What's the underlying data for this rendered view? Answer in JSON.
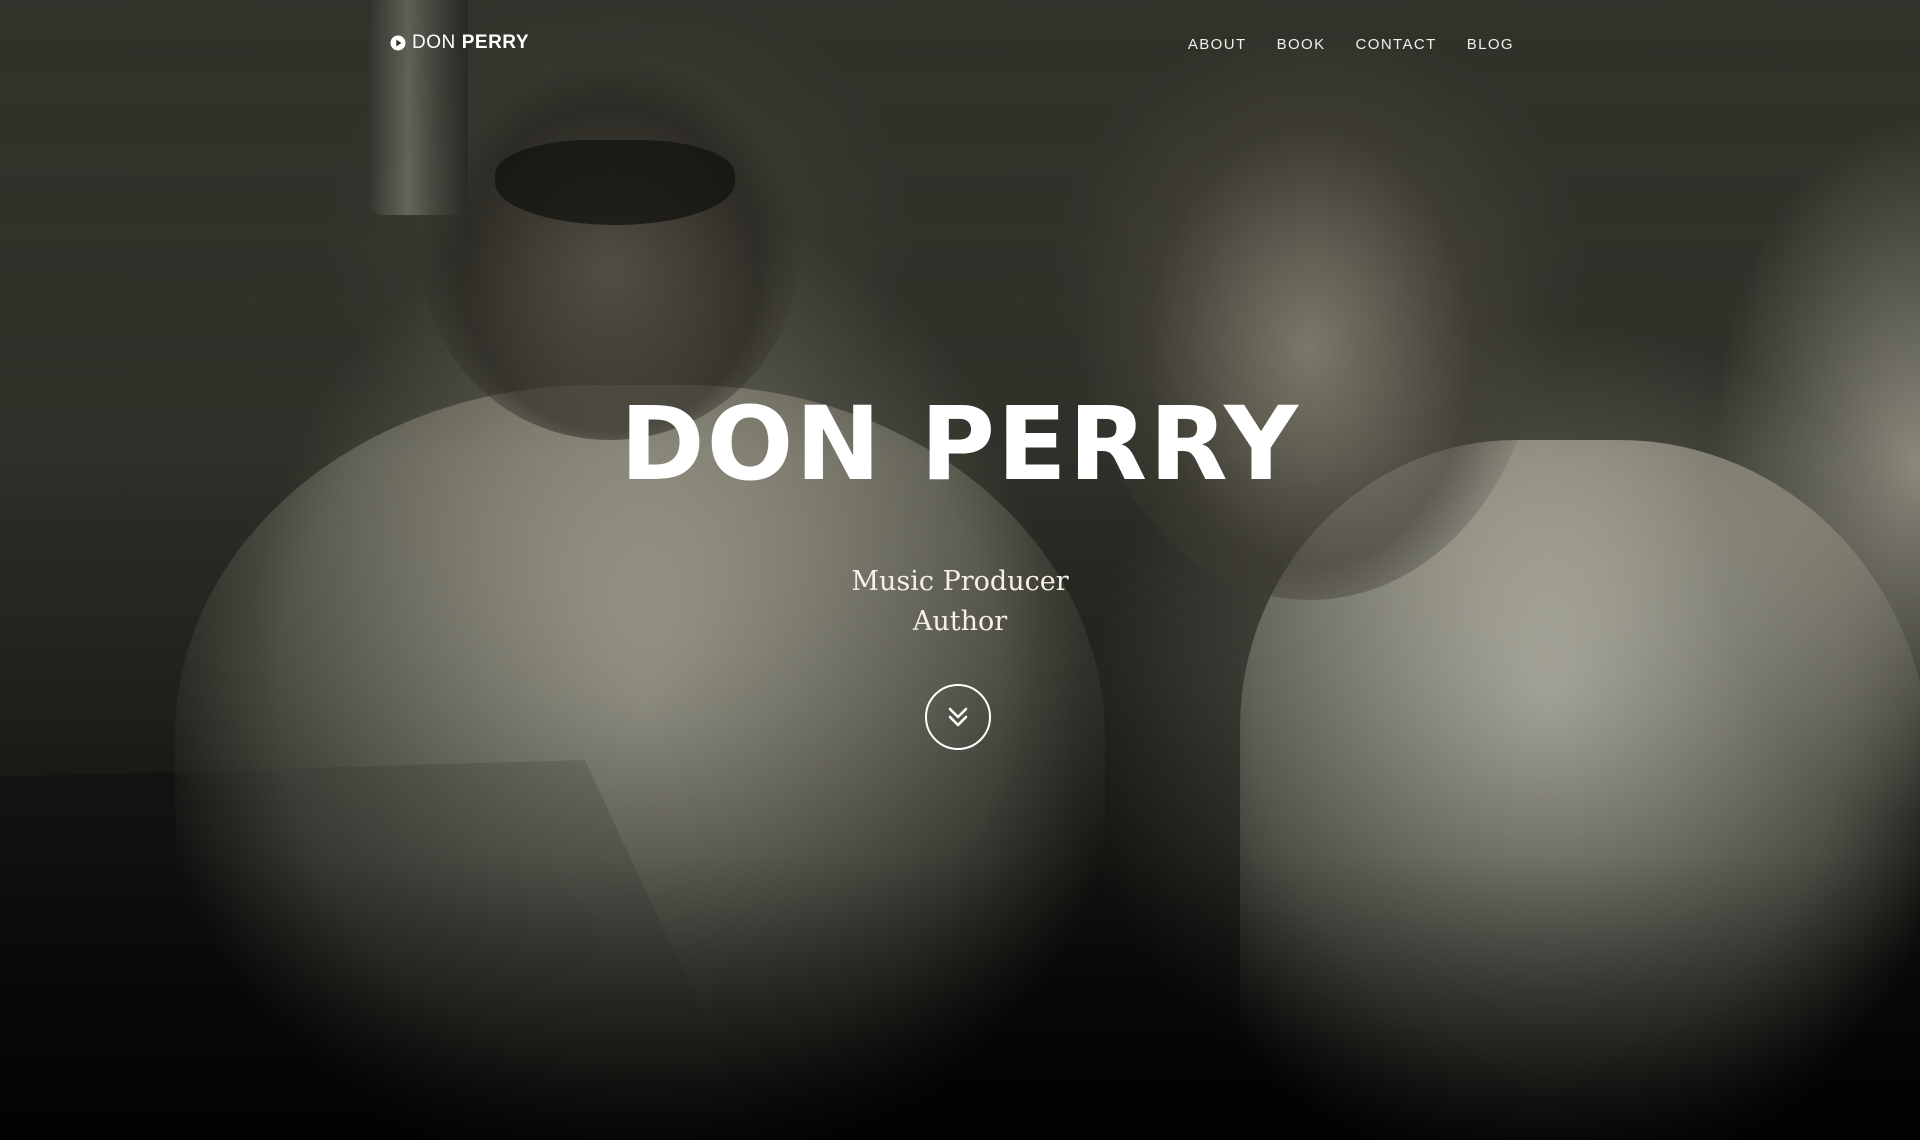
{
  "brand": {
    "first": "DON",
    "last": "PERRY",
    "icon": "play-circle-icon"
  },
  "nav": {
    "items": [
      {
        "label": "ABOUT"
      },
      {
        "label": "BOOK"
      },
      {
        "label": "CONTACT"
      },
      {
        "label": "BLOG"
      }
    ]
  },
  "hero": {
    "title": "DON PERRY",
    "subtitle_line1": "Music Producer",
    "subtitle_line2": "Author",
    "scroll_icon": "chevrons-down-icon"
  },
  "colors": {
    "text": "#ffffff",
    "background": "#2f2f29"
  }
}
